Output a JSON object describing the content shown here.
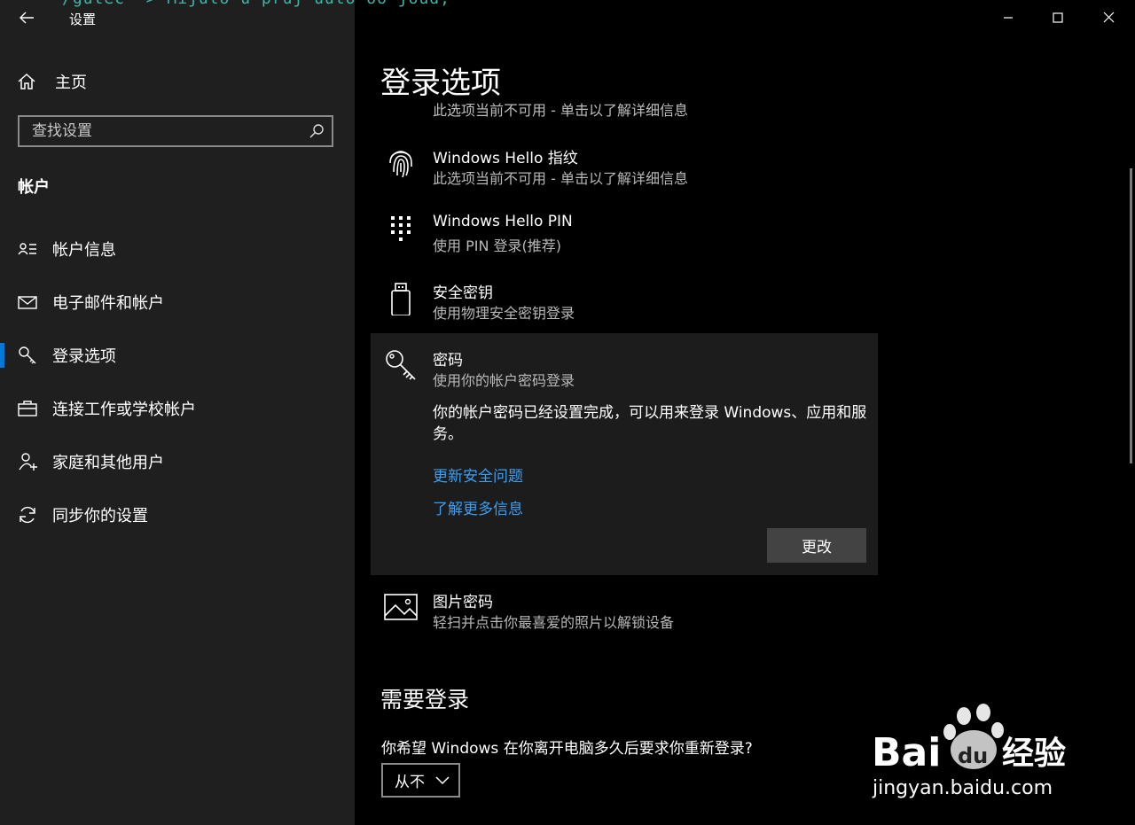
{
  "window": {
    "title": "设置",
    "background_code": "/gutec -> Mijuto u pruj uuto oo joud,"
  },
  "sidebar": {
    "home_label": "主页",
    "search_placeholder": "查找设置",
    "section": "帐户",
    "items": [
      {
        "label": "帐户信息",
        "icon": "account-info-icon"
      },
      {
        "label": "电子邮件和帐户",
        "icon": "mail-icon"
      },
      {
        "label": "登录选项",
        "icon": "key-icon",
        "active": true
      },
      {
        "label": "连接工作或学校帐户",
        "icon": "briefcase-icon"
      },
      {
        "label": "家庭和其他用户",
        "icon": "add-person-icon"
      },
      {
        "label": "同步你的设置",
        "icon": "sync-icon"
      }
    ]
  },
  "main": {
    "title": "登录选项",
    "cut_subtitle": "此选项当前不可用 - 单击以了解详细信息",
    "options": [
      {
        "title": "Windows Hello 指纹",
        "subtitle": "此选项当前不可用 - 单击以了解详细信息",
        "icon": "fingerprint-icon"
      },
      {
        "title": "Windows Hello PIN",
        "subtitle": "使用 PIN 登录(推荐)",
        "icon": "pin-keypad-icon"
      },
      {
        "title": "安全密钥",
        "subtitle": "使用物理安全密钥登录",
        "icon": "usb-key-icon"
      },
      {
        "title": "密码",
        "subtitle": "使用你的帐户密码登录",
        "icon": "password-key-icon"
      },
      {
        "title": "图片密码",
        "subtitle": "轻扫并点击你最喜爱的照片以解锁设备",
        "icon": "picture-icon"
      }
    ],
    "password_desc": "你的帐户密码已经设置完成，可以用来登录 Windows、应用和服务。",
    "link_security": "更新安全问题",
    "link_more": "了解更多信息",
    "change_btn": "更改",
    "need_signin_title": "需要登录",
    "question": "你希望 Windows 在你离开电脑多久后要求你重新登录?",
    "dropdown_value": "从不"
  },
  "watermark": {
    "brand": "Bai",
    "brand2": "du",
    "cn": "经验",
    "url": "jingyan.baidu.com"
  },
  "colors": {
    "accent": "#0078d7",
    "link": "#3a9ff0"
  }
}
